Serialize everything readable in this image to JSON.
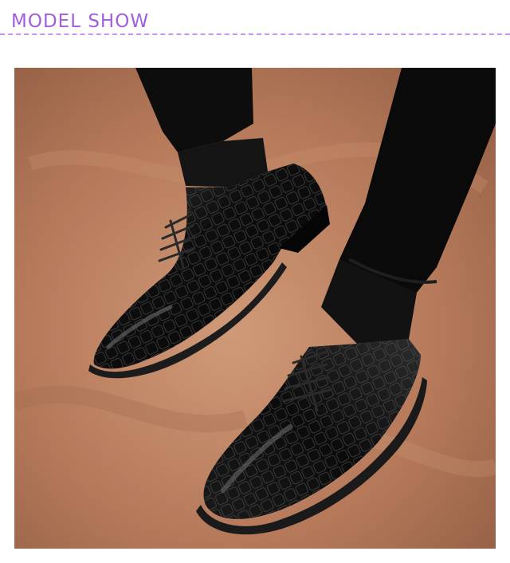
{
  "header": {
    "title": "MODEL SHOW",
    "accent_color": "#a25ee0",
    "divider_color": "#c693ee"
  },
  "photo": {
    "subject": "black-leather-oxford-shoes",
    "background_tone": "#b3775a"
  }
}
